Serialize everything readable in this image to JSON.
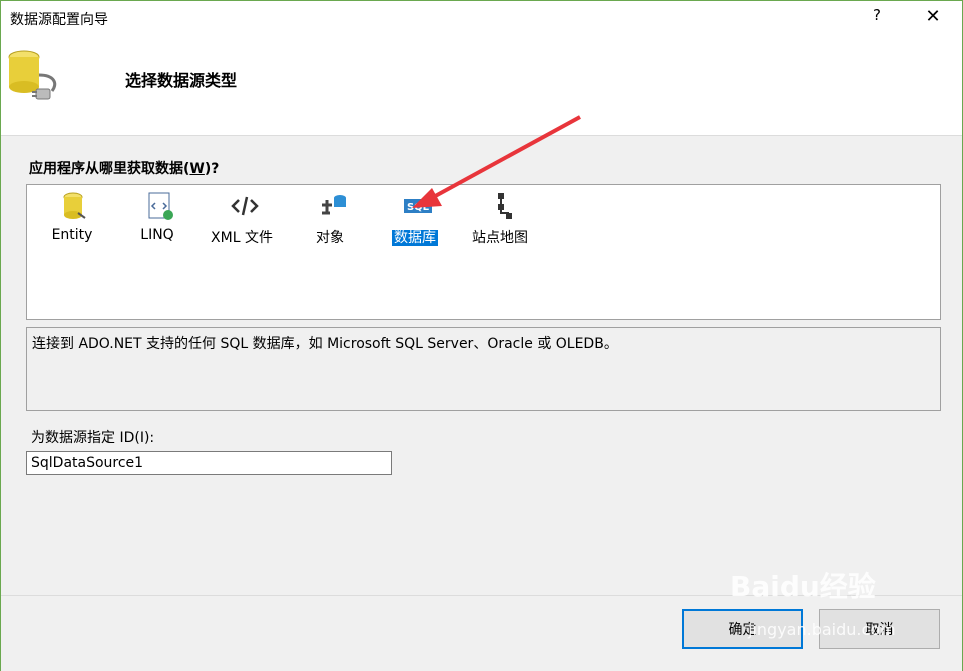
{
  "window": {
    "title": "数据源配置向导",
    "help": "?",
    "close": "✕"
  },
  "header": {
    "title": "选择数据源类型"
  },
  "question": {
    "prefix": "应用程序从哪里获取数据(",
    "mnemonic": "W",
    "suffix": ")?"
  },
  "sources": [
    {
      "label": "Entity",
      "icon": "entity-db-icon"
    },
    {
      "label": "LINQ",
      "icon": "linq-icon"
    },
    {
      "label": "XML 文件",
      "icon": "xml-icon"
    },
    {
      "label": "对象",
      "icon": "object-icon"
    },
    {
      "label": "数据库",
      "icon": "sql-icon",
      "selected": true
    },
    {
      "label": "站点地图",
      "icon": "sitemap-icon"
    }
  ],
  "description": "连接到 ADO.NET 支持的任何 SQL 数据库，如 Microsoft SQL Server、Oracle 或 OLEDB。",
  "id_field": {
    "label": "为数据源指定 ID(I):",
    "value": "SqlDataSource1"
  },
  "buttons": {
    "ok": "确定",
    "cancel": "取消"
  },
  "watermark": {
    "brand": "Baidu经验",
    "url": "jingyan.baidu.com"
  },
  "colors": {
    "selection": "#0078d7",
    "arrow": "#e8353b",
    "border": "#6aa84f"
  }
}
